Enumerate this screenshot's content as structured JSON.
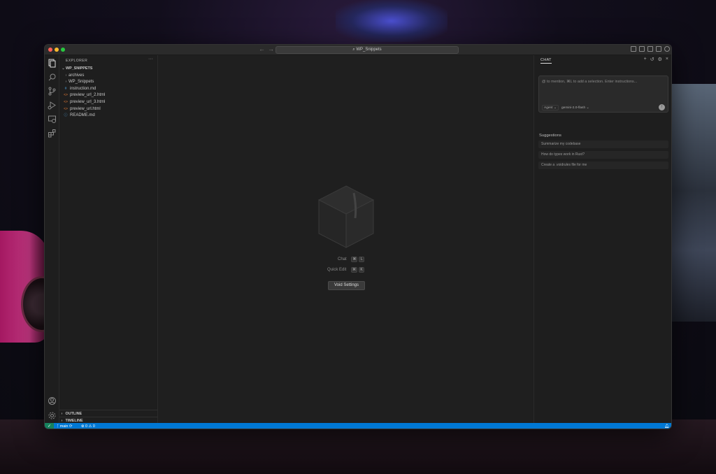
{
  "window": {
    "search_text": "WP_Snippets"
  },
  "sidebar": {
    "header": "EXPLORER",
    "more": "···",
    "root": "WP_SNIPPETS",
    "items": [
      {
        "label": "archives",
        "kind": "folder"
      },
      {
        "label": "WP_Snippets",
        "kind": "folder"
      },
      {
        "label": "instruction.md",
        "kind": "md"
      },
      {
        "label": "preview_url_2.html",
        "kind": "html"
      },
      {
        "label": "preview_url_3.html",
        "kind": "html"
      },
      {
        "label": "preview_url.html",
        "kind": "html"
      },
      {
        "label": "README.md",
        "kind": "info"
      }
    ],
    "outline": "OUTLINE",
    "timeline": "TIMELINE"
  },
  "editor": {
    "chat_label": "Chat",
    "chat_keys": [
      "⌘",
      "L"
    ],
    "quick_edit_label": "Quick Edit",
    "quick_edit_keys": [
      "⌘",
      "K"
    ],
    "settings_button": "Void Settings"
  },
  "chat": {
    "tab": "CHAT",
    "placeholder": "@ to mention, ⌘L to add a selection. Enter instructions...",
    "mode": "Agent",
    "model": "gemini-2.0-flash",
    "suggestions_title": "Suggestions",
    "suggestions": [
      "Summarize my codebase",
      "How do types work in Rust?",
      "Create a .voidrules file for me"
    ]
  },
  "statusbar": {
    "branch": "main",
    "problems": "⊗ 0 ⚠ 0"
  },
  "colors": {
    "accent": "#0078d4",
    "remote": "#16825d"
  }
}
